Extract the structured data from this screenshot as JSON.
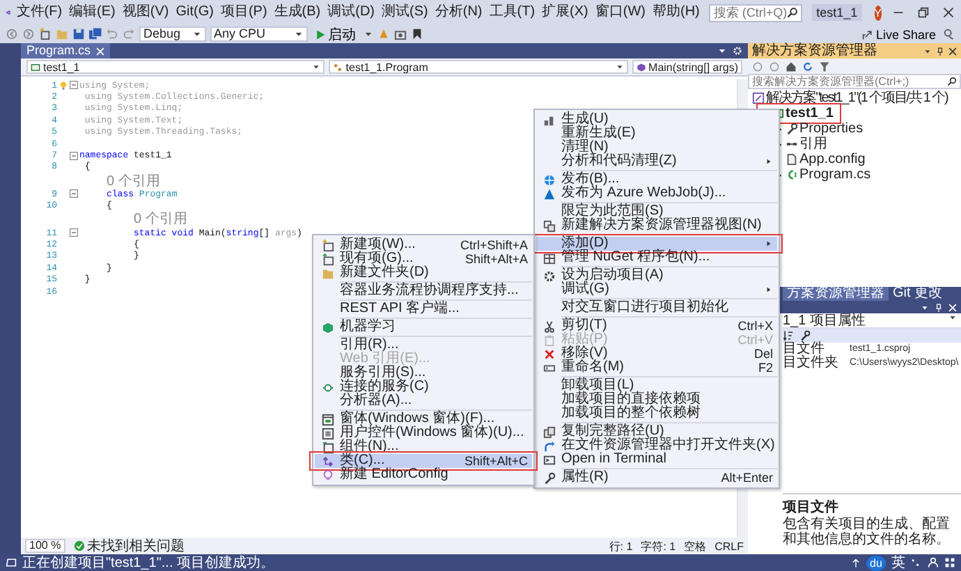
{
  "title_bar": {
    "menus": [
      "文件(F)",
      "编辑(E)",
      "视图(V)",
      "Git(G)",
      "项目(P)",
      "生成(B)",
      "调试(D)",
      "测试(S)",
      "分析(N)",
      "工具(T)",
      "扩展(X)",
      "窗口(W)",
      "帮助(H)"
    ],
    "search": {
      "placeholder": "搜索 (Ctrl+Q)"
    },
    "title": "test1_1",
    "avatar": "Y"
  },
  "toolbar": {
    "configuration": "Debug",
    "platform": "Any CPU",
    "start": "启动",
    "live_share": "Live Share"
  },
  "editor": {
    "tabs": [
      {
        "label": "Program.cs",
        "selected": true
      }
    ],
    "nav": [
      "test1_1",
      "test1_1.Program",
      "Main(string[] args)"
    ],
    "lines": [
      {
        "kind": "code",
        "number": "1",
        "foldable": true,
        "hint": true,
        "tokens": [
          {
            "text": "using System;",
            "kind": "dim"
          }
        ]
      },
      {
        "kind": "code",
        "number": "2",
        "foldable": false,
        "hint": false,
        "tokens": [
          {
            "text": " using System.Collections.Generic;",
            "kind": "dim"
          }
        ]
      },
      {
        "kind": "code",
        "number": "3",
        "foldable": false,
        "hint": false,
        "tokens": [
          {
            "text": " using System.Linq;",
            "kind": "dim"
          }
        ]
      },
      {
        "kind": "code",
        "number": "4",
        "foldable": false,
        "hint": false,
        "tokens": [
          {
            "text": " using System.Text;",
            "kind": "dim"
          }
        ]
      },
      {
        "kind": "code",
        "number": "5",
        "foldable": false,
        "hint": false,
        "tokens": [
          {
            "text": " using System.Threading.Tasks;",
            "kind": "dim"
          }
        ]
      },
      {
        "kind": "code",
        "number": "6",
        "foldable": false,
        "hint": false
      },
      {
        "kind": "code",
        "number": "7",
        "foldable": true,
        "hint": false,
        "tokens": [
          {
            "text": "namespace",
            "kind": "keyword"
          },
          {
            "text": " test1_1",
            "kind": "plain"
          }
        ]
      },
      {
        "kind": "code",
        "number": "8",
        "foldable": false,
        "hint": false,
        "tokens": [
          {
            "text": " {",
            "kind": "plain"
          }
        ]
      },
      {
        "kind": "lens",
        "text": "0 个引用"
      },
      {
        "kind": "code",
        "number": "9",
        "foldable": true,
        "hint": false,
        "tokens": [
          {
            "text": "     class",
            "kind": "keyword"
          },
          {
            "text": " Program",
            "kind": "type"
          }
        ]
      },
      {
        "kind": "code",
        "number": "10",
        "foldable": false,
        "hint": false,
        "tokens": [
          {
            "text": "     {",
            "kind": "plain"
          }
        ]
      },
      {
        "kind": "lens",
        "text": "0 个引用"
      },
      {
        "kind": "code",
        "number": "11",
        "foldable": true,
        "hint": false,
        "tokens": [
          {
            "text": "          static void",
            "kind": "keyword"
          },
          {
            "text": " Main(",
            "kind": "plain"
          },
          {
            "text": "string",
            "kind": "keyword"
          },
          {
            "text": "[] ",
            "kind": "plain"
          },
          {
            "text": "args",
            "kind": "dim"
          },
          {
            "text": ")",
            "kind": "plain"
          }
        ]
      },
      {
        "kind": "code",
        "number": "12",
        "foldable": false,
        "hint": false,
        "tokens": [
          {
            "text": "          {",
            "kind": "plain"
          }
        ]
      },
      {
        "kind": "code",
        "number": "13",
        "foldable": false,
        "hint": false,
        "tokens": [
          {
            "text": "          }",
            "kind": "plain"
          }
        ]
      },
      {
        "kind": "code",
        "number": "14",
        "foldable": false,
        "hint": false,
        "tokens": [
          {
            "text": "     }",
            "kind": "plain"
          }
        ]
      },
      {
        "kind": "code",
        "number": "15",
        "foldable": false,
        "hint": false,
        "tokens": [
          {
            "text": " }",
            "kind": "plain"
          }
        ]
      },
      {
        "kind": "code",
        "number": "16",
        "foldable": false,
        "hint": false
      }
    ],
    "status": {
      "zoom": "100 %",
      "issues": "未找到相关问题",
      "line": "行: 1",
      "char": "字符: 1",
      "spaces": "空格",
      "eol": "CRLF"
    }
  },
  "solution_explorer": {
    "title": "解决方案资源管理器",
    "search": {
      "placeholder": "搜索解决方案资源管理器(Ctrl+;)"
    },
    "tree": [
      {
        "kind": "solution",
        "label": "解决方案\"test1_1\"(1 个项目/共 1 个)",
        "selected": false,
        "expandable": false,
        "annotated": false,
        "children": [
          {
            "kind": "csproj",
            "label": "test1_1",
            "selected": true,
            "expandable": false,
            "annotated": true,
            "children": [
              {
                "kind": "properties",
                "label": "Properties",
                "selected": false,
                "expandable": true,
                "annotated": false
              },
              {
                "kind": "refs",
                "label": "引用",
                "selected": false,
                "expandable": true,
                "annotated": false
              },
              {
                "kind": "config",
                "label": "App.config",
                "selected": false,
                "expandable": false,
                "annotated": false
              },
              {
                "kind": "cs",
                "label": "Program.cs",
                "selected": false,
                "expandable": true,
                "annotated": false
              }
            ]
          }
        ]
      }
    ]
  },
  "panel_tabs": [
    {
      "label": "方案资源管理器",
      "selected": true
    },
    {
      "label": "Git 更改",
      "selected": false
    }
  ],
  "properties": {
    "object": "1_1  项目属性",
    "rows": [
      {
        "name": "目文件",
        "value": "test1_1.csproj"
      },
      {
        "name": "目文件夹",
        "value": "C:\\Users\\wyys2\\Desktop\\"
      }
    ],
    "description_title": "项目文件",
    "description": "包含有关项目的生成、配置和其他信息的文件的名称。"
  },
  "context_menu": {
    "items": [
      {
        "kind": "item",
        "label": "生成(U)",
        "submenu": false,
        "selected": false,
        "disabled": false,
        "annotated": false
      },
      {
        "kind": "item",
        "label": "重新生成(E)",
        "submenu": false,
        "selected": false,
        "disabled": false,
        "annotated": false
      },
      {
        "kind": "item",
        "label": "清理(N)",
        "submenu": false,
        "selected": false,
        "disabled": false,
        "annotated": false
      },
      {
        "kind": "item",
        "label": "分析和代码清理(Z)",
        "submenu": true,
        "selected": false,
        "disabled": false,
        "annotated": false
      },
      {
        "kind": "separator"
      },
      {
        "kind": "item",
        "label": "发布(B)...",
        "submenu": false,
        "selected": false,
        "disabled": false,
        "annotated": false
      },
      {
        "kind": "item",
        "label": "发布为 Azure WebJob(J)...",
        "submenu": false,
        "selected": false,
        "disabled": false,
        "annotated": false
      },
      {
        "kind": "separator"
      },
      {
        "kind": "item",
        "label": "限定为此范围(S)",
        "submenu": false,
        "selected": false,
        "disabled": false,
        "annotated": false
      },
      {
        "kind": "item",
        "label": "新建解决方案资源管理器视图(N)",
        "submenu": false,
        "selected": false,
        "disabled": false,
        "annotated": false
      },
      {
        "kind": "separator"
      },
      {
        "kind": "item",
        "label": "添加(D)",
        "submenu": true,
        "selected": true,
        "disabled": false,
        "annotated": true
      },
      {
        "kind": "item",
        "label": "管理 NuGet 程序包(N)...",
        "submenu": false,
        "selected": false,
        "disabled": false,
        "annotated": false
      },
      {
        "kind": "separator"
      },
      {
        "kind": "item",
        "label": "设为启动项目(A)",
        "submenu": false,
        "selected": false,
        "disabled": false,
        "annotated": false
      },
      {
        "kind": "item",
        "label": "调试(G)",
        "submenu": true,
        "selected": false,
        "disabled": false,
        "annotated": false
      },
      {
        "kind": "separator"
      },
      {
        "kind": "item",
        "label": "对交互窗口进行项目初始化",
        "submenu": false,
        "selected": false,
        "disabled": false,
        "annotated": false
      },
      {
        "kind": "separator"
      },
      {
        "kind": "item",
        "label": "剪切(T)",
        "shortcut": "Ctrl+X",
        "submenu": false,
        "selected": false,
        "disabled": false,
        "annotated": false
      },
      {
        "kind": "item",
        "label": "粘贴(P)",
        "shortcut": "Ctrl+V",
        "submenu": false,
        "selected": false,
        "disabled": true,
        "annotated": false
      },
      {
        "kind": "item",
        "label": "移除(V)",
        "shortcut": "Del",
        "submenu": false,
        "selected": false,
        "disabled": false,
        "annotated": false
      },
      {
        "kind": "item",
        "label": "重命名(M)",
        "shortcut": "F2",
        "submenu": false,
        "selected": false,
        "disabled": false,
        "annotated": false
      },
      {
        "kind": "separator"
      },
      {
        "kind": "item",
        "label": "卸载项目(L)",
        "submenu": false,
        "selected": false,
        "disabled": false,
        "annotated": false
      },
      {
        "kind": "item",
        "label": "加载项目的直接依赖项",
        "submenu": false,
        "selected": false,
        "disabled": false,
        "annotated": false
      },
      {
        "kind": "item",
        "label": "加载项目的整个依赖树",
        "submenu": false,
        "selected": false,
        "disabled": false,
        "annotated": false
      },
      {
        "kind": "separator"
      },
      {
        "kind": "item",
        "label": "复制完整路径(U)",
        "submenu": false,
        "selected": false,
        "disabled": false,
        "annotated": false
      },
      {
        "kind": "item",
        "label": "在文件资源管理器中打开文件夹(X)",
        "submenu": false,
        "selected": false,
        "disabled": false,
        "annotated": false
      },
      {
        "kind": "item",
        "label": "Open in Terminal",
        "submenu": false,
        "selected": false,
        "disabled": false,
        "annotated": false
      },
      {
        "kind": "separator"
      },
      {
        "kind": "item",
        "label": "属性(R)",
        "shortcut": "Alt+Enter",
        "submenu": false,
        "selected": false,
        "disabled": false,
        "annotated": false
      }
    ]
  },
  "submenu": {
    "items": [
      {
        "kind": "item",
        "label": "新建项(W)...",
        "shortcut": "Ctrl+Shift+A",
        "selected": false,
        "disabled": false,
        "annotated": false
      },
      {
        "kind": "item",
        "label": "现有项(G)...",
        "shortcut": "Shift+Alt+A",
        "selected": false,
        "disabled": false,
        "annotated": false
      },
      {
        "kind": "item",
        "label": "新建文件夹(D)",
        "selected": false,
        "disabled": false,
        "annotated": false
      },
      {
        "kind": "separator"
      },
      {
        "kind": "item",
        "label": "容器业务流程协调程序支持...",
        "selected": false,
        "disabled": false,
        "annotated": false
      },
      {
        "kind": "separator"
      },
      {
        "kind": "item",
        "label": "REST API 客户端...",
        "selected": false,
        "disabled": false,
        "annotated": false
      },
      {
        "kind": "separator"
      },
      {
        "kind": "item",
        "label": "机器学习",
        "selected": false,
        "disabled": false,
        "annotated": false
      },
      {
        "kind": "separator"
      },
      {
        "kind": "item",
        "label": "引用(R)...",
        "selected": false,
        "disabled": false,
        "annotated": false
      },
      {
        "kind": "item",
        "label": "Web 引用(E)...",
        "selected": false,
        "disabled": true,
        "annotated": false
      },
      {
        "kind": "item",
        "label": "服务引用(S)...",
        "selected": false,
        "disabled": false,
        "annotated": false
      },
      {
        "kind": "item",
        "label": "连接的服务(C)",
        "selected": false,
        "disabled": false,
        "annotated": false
      },
      {
        "kind": "item",
        "label": "分析器(A)...",
        "selected": false,
        "disabled": false,
        "annotated": false
      },
      {
        "kind": "separator"
      },
      {
        "kind": "item",
        "label": "窗体(Windows 窗体)(F)...",
        "selected": false,
        "disabled": false,
        "annotated": false
      },
      {
        "kind": "item",
        "label": "用户控件(Windows 窗体)(U)...",
        "selected": false,
        "disabled": false,
        "annotated": false
      },
      {
        "kind": "item",
        "label": "组件(N)...",
        "selected": false,
        "disabled": false,
        "annotated": false
      },
      {
        "kind": "item",
        "label": "类(C)...",
        "shortcut": "Shift+Alt+C",
        "selected": true,
        "disabled": false,
        "annotated": true
      },
      {
        "kind": "item",
        "label": "新建 EditorConfig",
        "selected": false,
        "disabled": false,
        "annotated": false
      }
    ]
  },
  "status_bar": {
    "message": "正在创建项目\"test1_1\"... 项目创建成功。",
    "tray": {
      "badge": "du",
      "ime": "英"
    }
  }
}
